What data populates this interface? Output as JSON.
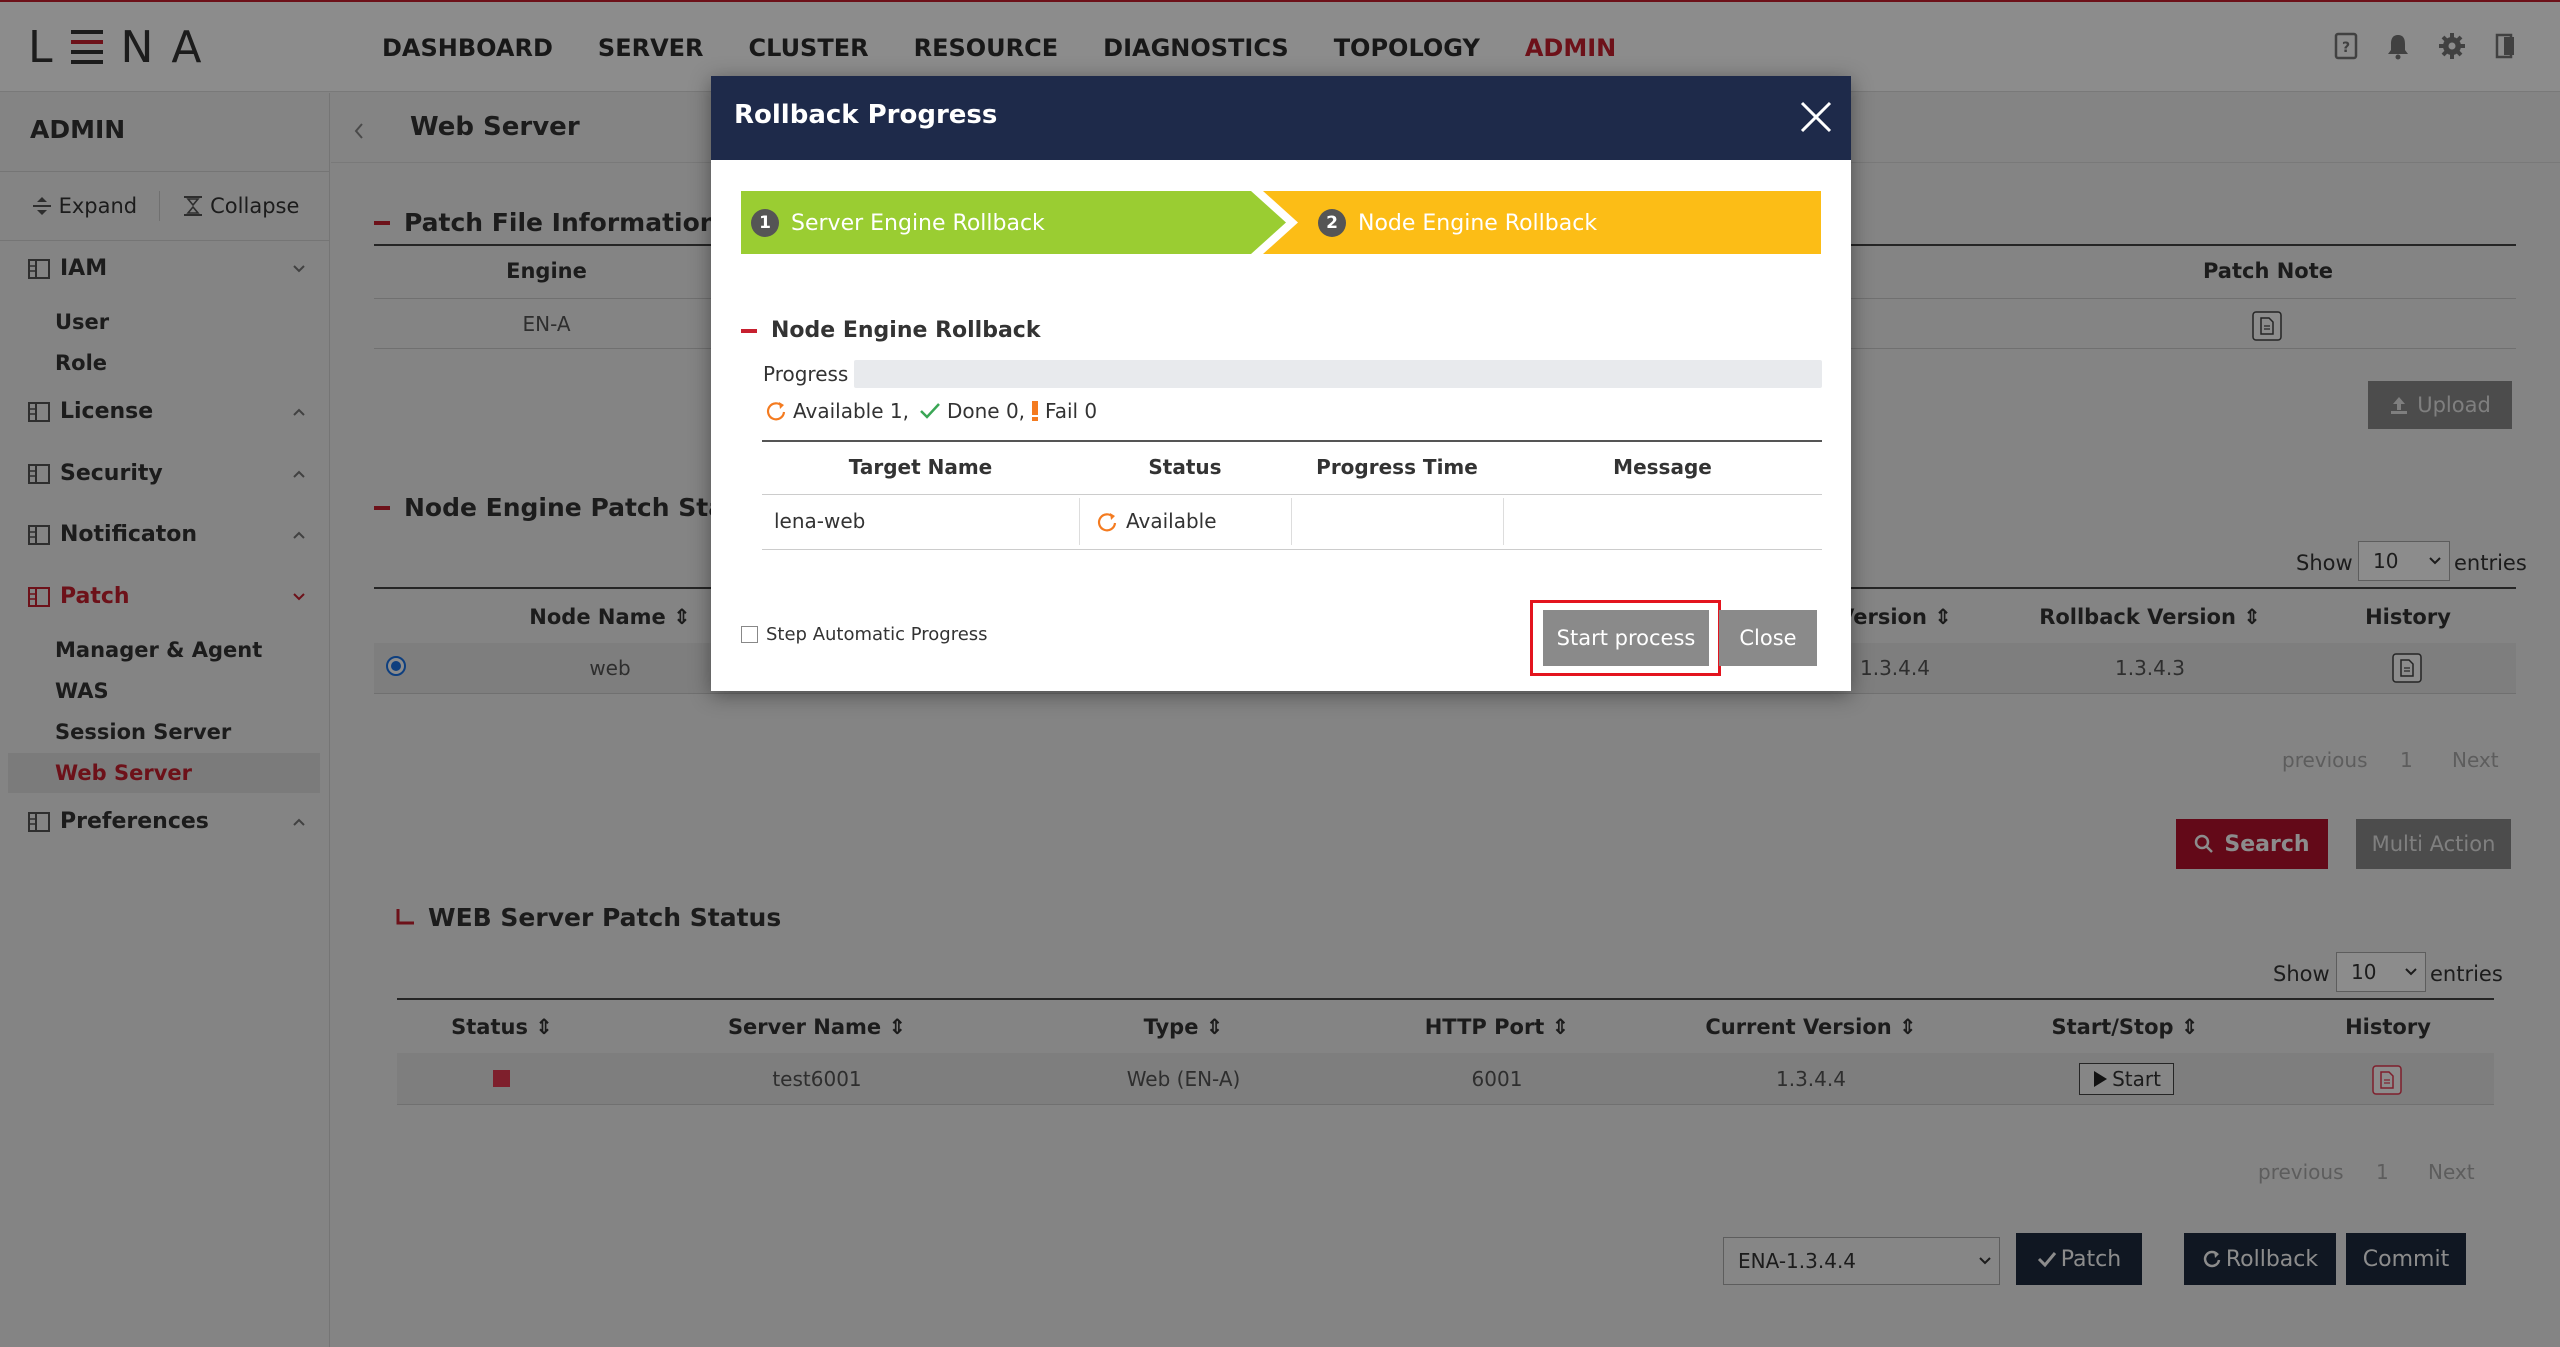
{
  "app": {
    "logo": "LENA"
  },
  "nav": {
    "items": [
      "DASHBOARD",
      "SERVER",
      "CLUSTER",
      "RESOURCE",
      "DIAGNOSTICS",
      "TOPOLOGY",
      "ADMIN"
    ],
    "active": "ADMIN"
  },
  "sidebar": {
    "title": "ADMIN",
    "expand": "Expand",
    "collapse": "Collapse",
    "groups": [
      {
        "label": "IAM",
        "subs": [
          "User",
          "Role"
        ]
      },
      {
        "label": "License"
      },
      {
        "label": "Security"
      },
      {
        "label": "Notificaton"
      },
      {
        "label": "Patch",
        "subs": [
          "Manager & Agent",
          "WAS",
          "Session Server",
          "Web Server"
        ],
        "active_sub": "Web Server"
      },
      {
        "label": "Preferences"
      }
    ]
  },
  "page": {
    "title": "Web Server"
  },
  "patch_file": {
    "title": "Patch File Information",
    "headers": [
      "Engine",
      "Patch Note"
    ],
    "row": [
      "EN-A"
    ],
    "upload": "Upload"
  },
  "node_status": {
    "title": "Node Engine Patch Status",
    "show": "Show",
    "entries": "entries",
    "page_size": "10",
    "headers": [
      "Node Name",
      "Version",
      "Rollback Version",
      "History"
    ],
    "row": [
      "web",
      "1.3.4.4",
      "1.3.4.3"
    ],
    "pager": {
      "prev": "previous",
      "page": "1",
      "next": "Next"
    },
    "search": "Search",
    "multi": "Multi Action"
  },
  "web_status": {
    "title": "WEB Server Patch Status",
    "show": "Show",
    "entries": "entries",
    "page_size": "10",
    "headers": [
      "Status",
      "Server Name",
      "Type",
      "HTTP Port",
      "Current Version",
      "Start/Stop",
      "History"
    ],
    "row": {
      "server": "test6001",
      "type": "Web (EN-A)",
      "port": "6001",
      "version": "1.3.4.4",
      "start": "Start"
    },
    "pager": {
      "prev": "previous",
      "page": "1",
      "next": "Next"
    },
    "version_select": "ENA-1.3.4.4",
    "patch": "Patch",
    "rollback": "Rollback",
    "commit": "Commit"
  },
  "modal": {
    "title": "Rollback Progress",
    "steps": [
      {
        "num": "1",
        "label": "Server Engine Rollback"
      },
      {
        "num": "2",
        "label": "Node Engine Rollback"
      }
    ],
    "section": "Node Engine Rollback",
    "progress_label": "Progress",
    "progress": 0,
    "counts": {
      "available": "Available 1,",
      "done": "Done 0,",
      "fail": "Fail 0"
    },
    "headers": [
      "Target Name",
      "Status",
      "Progress Time",
      "Message"
    ],
    "row": {
      "target": "lena-web",
      "status": "Available",
      "time": "",
      "message": ""
    },
    "step_auto": "Step Automatic Progress",
    "start": "Start process",
    "close": "Close"
  },
  "colors": {
    "accent": "#c7202f",
    "modal_header": "#1e2a4a",
    "step1": "#9acd32",
    "step2": "#fcbd16",
    "dark_button": "#1e2a3e",
    "red_button": "#b4122d"
  }
}
